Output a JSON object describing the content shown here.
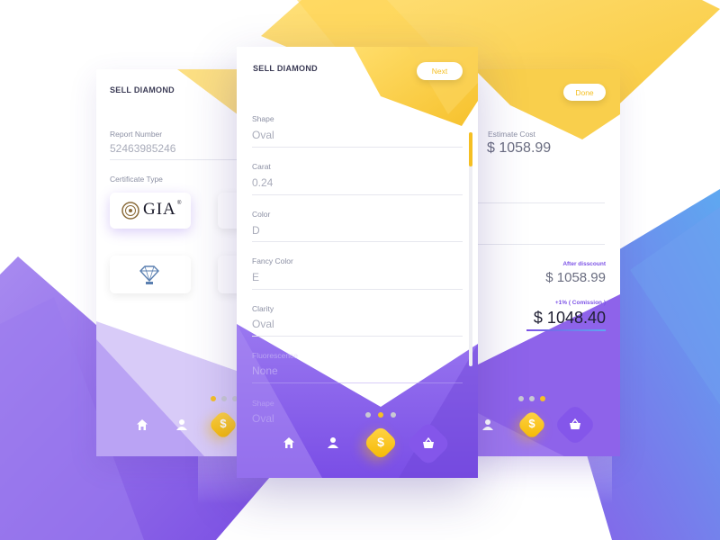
{
  "colors": {
    "accent_yellow": "#f5bf22",
    "accent_purple": "#7c52e6",
    "text_dark": "#3b3b55"
  },
  "left_card": {
    "title": "SELL DIAMOND",
    "report_label": "Report Number",
    "report_value": "52463985246",
    "cert_label": "Certificate Type",
    "gia_text": "GIA",
    "gia_reg": "®",
    "igi_icon": "diamond-cert-icon",
    "pagination_active": 0
  },
  "center_card": {
    "title": "SELL DIAMOND",
    "next_label": "Next",
    "fields": [
      {
        "label": "Shape",
        "value": "Oval"
      },
      {
        "label": "Carat",
        "value": "0.24"
      },
      {
        "label": "Color",
        "value": "D"
      },
      {
        "label": "Fancy Color",
        "value": "E"
      },
      {
        "label": "Clarity",
        "value": "Oval"
      },
      {
        "label": "Fluorescence",
        "value": "None"
      },
      {
        "label": "Shape",
        "value": "Oval"
      }
    ],
    "pagination_active": 1,
    "nav": [
      "home-icon",
      "user-icon",
      "dollar-icon",
      "basket-icon"
    ],
    "fab_glyph": "$"
  },
  "right_card": {
    "done_label": "Done",
    "estimate_label": "Estimate Cost",
    "estimate_value": "$ 1058.99",
    "after_label": "After disscount",
    "after_value": "$ 1058.99",
    "commission_label": "+1% ( Comission )",
    "commission_value": "$ 1048.40",
    "pagination_active": 2,
    "fab_glyph": "$"
  }
}
